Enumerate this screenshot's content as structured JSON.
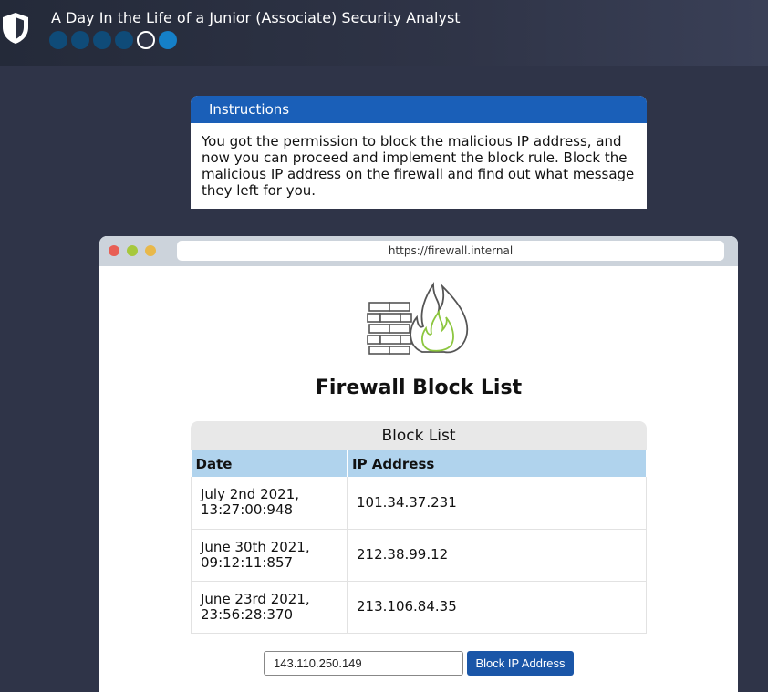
{
  "app": {
    "title": "A Day In the Life of a Junior (Associate) Security Analyst",
    "progress": {
      "total_steps": 6,
      "current_step": 5
    }
  },
  "instructions": {
    "heading": "Instructions",
    "body": "You got the permission to block the malicious IP address, and now you can proceed and implement the block rule. Block the malicious IP address on the firewall and find out what message they left for you."
  },
  "browser": {
    "url": "https://firewall.internal"
  },
  "page": {
    "title": "Firewall Block List"
  },
  "block_list": {
    "caption": "Block List",
    "columns": [
      "Date",
      "IP Address"
    ],
    "rows": [
      {
        "date_line1": "July 2nd 2021,",
        "date_line2": "13:27:00:948",
        "ip": "101.34.37.231"
      },
      {
        "date_line1": "June 30th 2021,",
        "date_line2": "09:12:11:857",
        "ip": "212.38.99.12"
      },
      {
        "date_line1": "June 23rd 2021,",
        "date_line2": "23:56:28:370",
        "ip": "213.106.84.35"
      }
    ]
  },
  "block_form": {
    "input_value": "143.110.250.149",
    "button_label": "Block IP Address"
  },
  "colors": {
    "accent": "#1a5fb8",
    "table_header": "#b0d3ed",
    "progress_done": "#0f4b78",
    "progress_next": "#1580c8"
  },
  "icons": [
    "shield-icon",
    "firewall-icon"
  ]
}
